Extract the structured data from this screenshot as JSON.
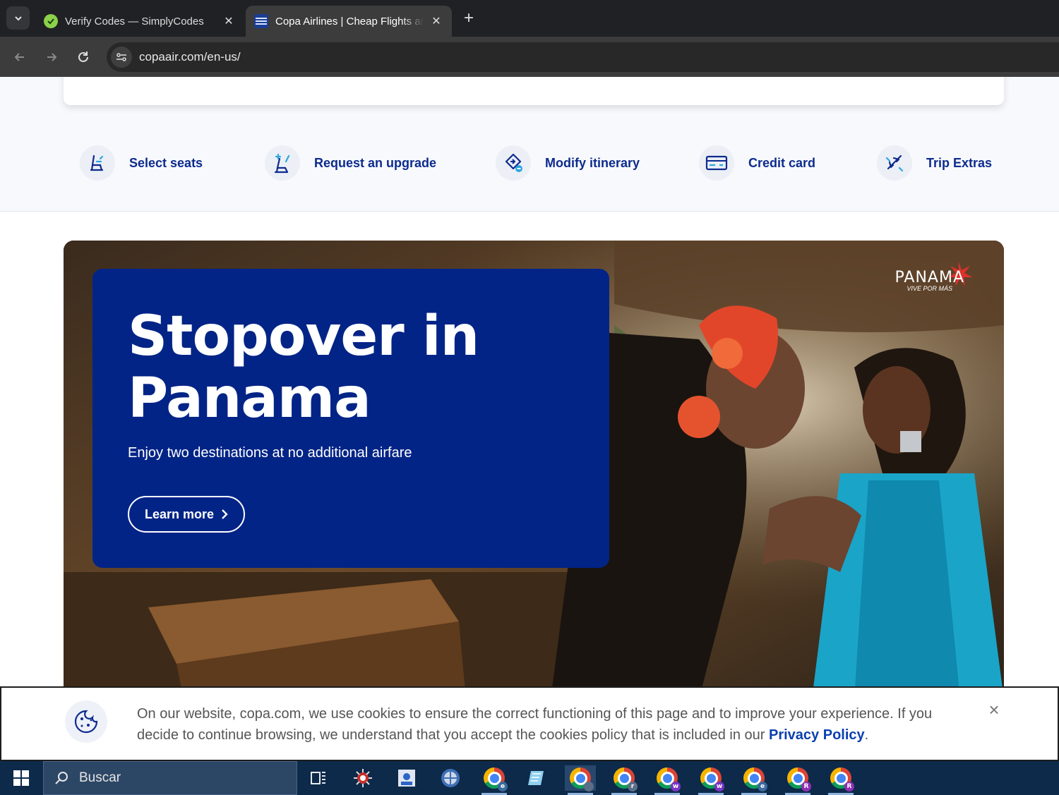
{
  "browser": {
    "tabs": [
      {
        "title": "Verify Codes — SimplyCodes",
        "active": false
      },
      {
        "title": "Copa Airlines | Cheap Flights and",
        "active": true
      }
    ],
    "new_tab_label": "+",
    "close_glyph": "✕",
    "url": "copaair.com/en-us/"
  },
  "quick_links": [
    {
      "label": "Select seats",
      "icon": "seat-icon"
    },
    {
      "label": "Request an upgrade",
      "icon": "upgrade-seat-icon"
    },
    {
      "label": "Modify itinerary",
      "icon": "modify-itinerary-icon"
    },
    {
      "label": "Credit card",
      "icon": "credit-card-icon"
    },
    {
      "label": "Trip Extras",
      "icon": "plane-extras-icon"
    }
  ],
  "hero": {
    "title": "Stopover in Panama",
    "subtitle": "Enjoy two destinations at no additional airfare",
    "cta": "Learn more",
    "logo_text": "PANAMA",
    "logo_tagline": "VIVE POR MÁS"
  },
  "cookie_banner": {
    "text": "On our website, copa.com, we use cookies to ensure the correct functioning of this page and to improve your experience. If you decide to continue browsing, we understand that you accept the cookies policy that is included in our ",
    "link": "Privacy Policy",
    "end": ".",
    "close": "×"
  },
  "taskbar": {
    "search_placeholder": "Buscar",
    "chrome_badges": [
      "e",
      "",
      "r",
      "r",
      "w",
      "w",
      "e",
      "R",
      "R"
    ]
  },
  "colors": {
    "brand_blue": "#022487",
    "link_blue": "#0d2b8e",
    "taskbar": "#0d2a4a"
  }
}
